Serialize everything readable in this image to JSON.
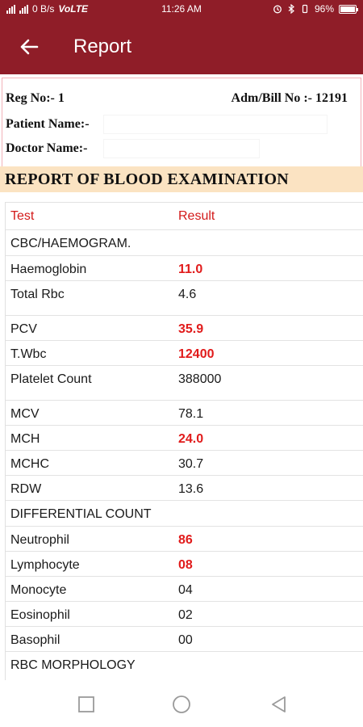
{
  "status_bar": {
    "speed": "0 B/s",
    "network": "VoLTE",
    "time": "11:26 AM",
    "battery": "96%"
  },
  "app_bar": {
    "title": "Report"
  },
  "report_header": {
    "reg_no": "Reg No:-  1",
    "adm_bill_no": "Adm/Bill No :-  12191",
    "patient_name_label": "Patient Name:-",
    "doctor_name_label": "Doctor Name:-",
    "section_title": "REPORT OF BLOOD EXAMINATION"
  },
  "table": {
    "headers": {
      "test": "Test",
      "result": "Result"
    },
    "rows": [
      {
        "test": "CBC/HAEMOGRAM.",
        "result": "",
        "type": "section"
      },
      {
        "test": "Haemoglobin",
        "result": "11.0",
        "abnormal": true
      },
      {
        "test": "Total Rbc",
        "result": "4.6",
        "abnormal": false
      },
      {
        "test": "PCV",
        "result": "35.9",
        "abnormal": true
      },
      {
        "test": "T.Wbc",
        "result": "12400",
        "abnormal": true
      },
      {
        "test": "Platelet Count",
        "result": "388000",
        "abnormal": false
      },
      {
        "test": "MCV",
        "result": "78.1",
        "abnormal": false
      },
      {
        "test": "MCH",
        "result": "24.0",
        "abnormal": true
      },
      {
        "test": "MCHC",
        "result": "30.7",
        "abnormal": false
      },
      {
        "test": "RDW",
        "result": "13.6",
        "abnormal": false
      },
      {
        "test": "DIFFERENTIAL COUNT",
        "result": "",
        "type": "section"
      },
      {
        "test": "Neutrophil",
        "result": "86",
        "abnormal": true
      },
      {
        "test": "Lymphocyte",
        "result": "08",
        "abnormal": true
      },
      {
        "test": "Monocyte",
        "result": "04",
        "abnormal": false
      },
      {
        "test": "Eosinophil",
        "result": "02",
        "abnormal": false
      },
      {
        "test": "Basophil",
        "result": "00",
        "abnormal": false
      },
      {
        "test": "RBC MORPHOLOGY",
        "result": "",
        "type": "section"
      }
    ]
  },
  "colors": {
    "app_bar": "#8f1d28",
    "abnormal": "#e11b1b",
    "header_text": "#d31a1a",
    "report_title_bg": "#fbe3c2"
  },
  "icons": {
    "back": "arrow-left-icon",
    "nav_recents": "square-icon",
    "nav_home": "circle-icon",
    "nav_back": "triangle-back-icon"
  }
}
